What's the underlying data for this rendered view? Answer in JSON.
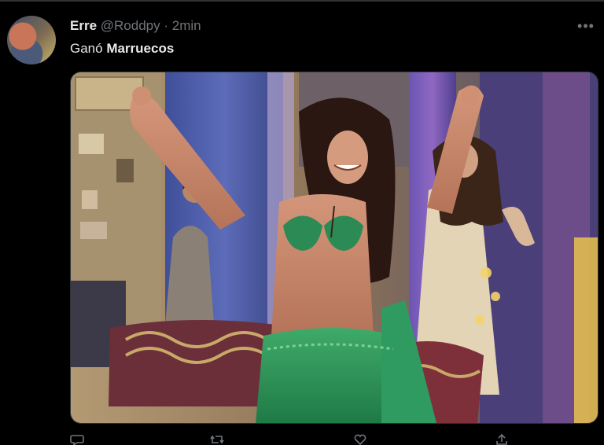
{
  "tweet": {
    "display_name": "Erre",
    "handle": "@Roddpy",
    "separator": "·",
    "time": "2min",
    "text_prefix": "Ganó ",
    "text_bold": "Marruecos"
  },
  "icons": {
    "more": "more-horizontal-icon",
    "actions": [
      "reply-icon",
      "retweet-icon",
      "like-icon",
      "share-icon"
    ]
  },
  "colors": {
    "background": "#000000",
    "text_primary": "#e7e9ea",
    "text_secondary": "#71767b",
    "border": "#2f3336"
  }
}
